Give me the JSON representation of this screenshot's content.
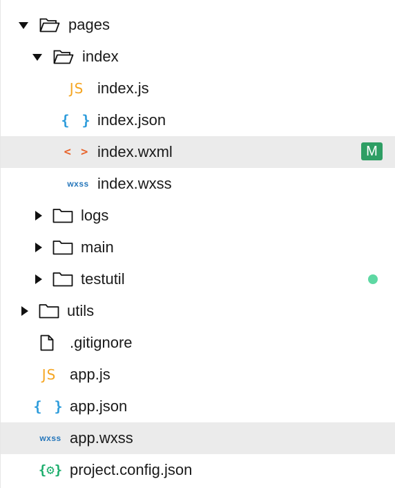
{
  "tree": {
    "pages": {
      "label": "pages"
    },
    "index_folder": {
      "label": "index"
    },
    "index_js": {
      "label": "index.js",
      "icon_text": "JS"
    },
    "index_json": {
      "label": "index.json",
      "icon_text": "{ }"
    },
    "index_wxml": {
      "label": "index.wxml",
      "icon_text": "< >",
      "badge": "M"
    },
    "index_wxss": {
      "label": "index.wxss",
      "icon_text": "wxss"
    },
    "logs": {
      "label": "logs"
    },
    "main": {
      "label": "main"
    },
    "testutil": {
      "label": "testutil"
    },
    "utils": {
      "label": "utils"
    },
    "gitignore": {
      "label": ".gitignore"
    },
    "app_js": {
      "label": "app.js",
      "icon_text": "JS"
    },
    "app_json": {
      "label": "app.json",
      "icon_text": "{ }"
    },
    "app_wxss": {
      "label": "app.wxss",
      "icon_text": "wxss"
    },
    "project_config": {
      "label": "project.config.json",
      "icon_text": "{⚙}"
    }
  },
  "colors": {
    "modified_badge": "#2e9e64",
    "untracked_dot": "#5ed8a3",
    "selected_row": "#ebebeb",
    "js": "#f5a623",
    "json": "#2d9cdb",
    "wxml": "#e8642c",
    "wxss": "#2677bb",
    "config": "#1aad6b"
  }
}
